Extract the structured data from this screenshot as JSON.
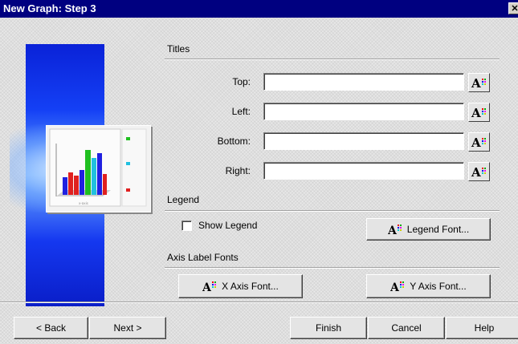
{
  "window": {
    "title": "New Graph: Step 3",
    "close_label": "✕"
  },
  "sections": {
    "titles": "Titles",
    "legend": "Legend",
    "axis": "Axis Label Fonts"
  },
  "fields": [
    {
      "label": "Top:",
      "value": ""
    },
    {
      "label": "Left:",
      "value": ""
    },
    {
      "label": "Bottom:",
      "value": ""
    },
    {
      "label": "Right:",
      "value": ""
    }
  ],
  "legend": {
    "show_label": "Show Legend",
    "checked": false,
    "font_button": "Legend Font..."
  },
  "axis": {
    "x_button": "X Axis Font...",
    "y_button": "Y Axis Font..."
  },
  "footer": {
    "back": "< Back",
    "next": "Next >",
    "finish": "Finish",
    "cancel": "Cancel",
    "help": "Help"
  },
  "preview_chart": {
    "bar_colors": [
      "#2020e0",
      "#e02020",
      "#20c020",
      "#20c0e0"
    ]
  }
}
